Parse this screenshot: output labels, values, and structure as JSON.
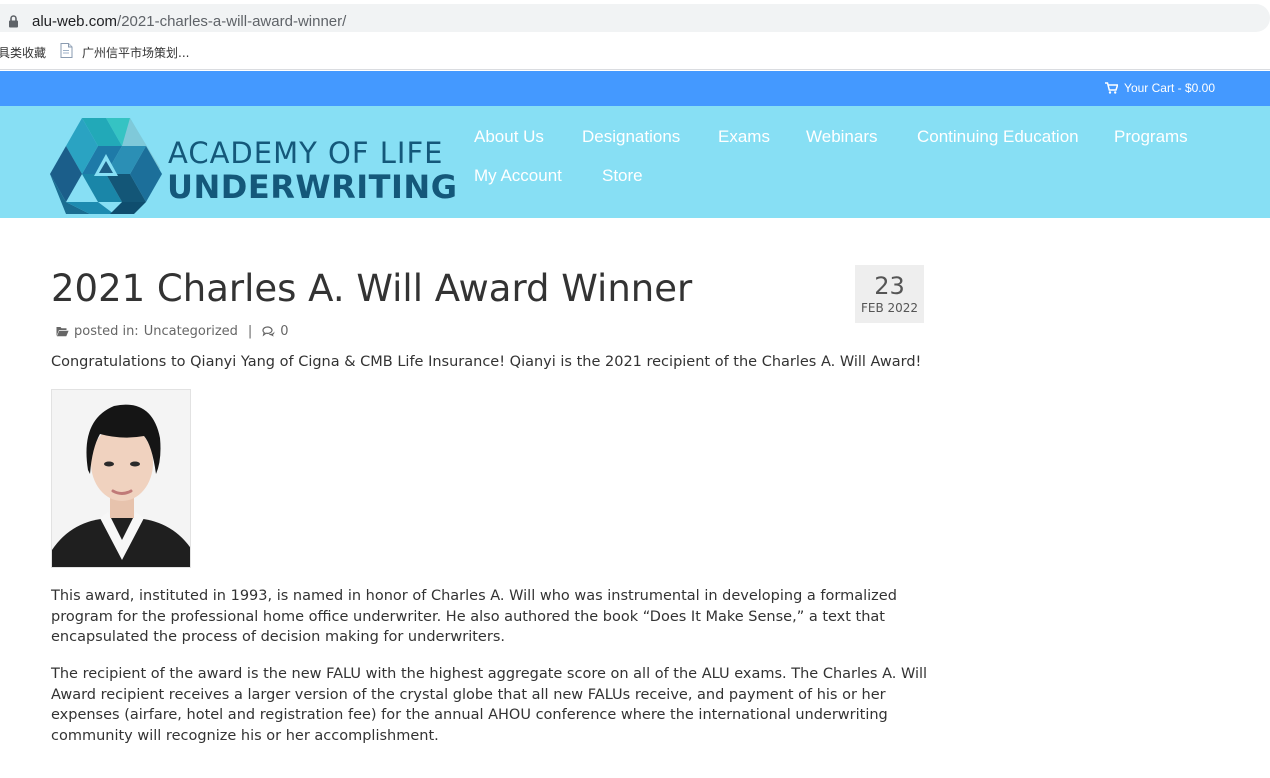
{
  "browser": {
    "url_host": "alu-web.com",
    "url_path": "/2021-charles-a-will-award-winner/",
    "bookmarks": [
      {
        "label": "具类收藏"
      },
      {
        "label": "广州信平市场策划..."
      }
    ]
  },
  "cart": {
    "label": "Your Cart - $0.00"
  },
  "logo": {
    "line1": "ACADEMY OF LIFE",
    "line2": "UNDERWRITING"
  },
  "nav": {
    "items": [
      {
        "label": "About Us"
      },
      {
        "label": "Designations"
      },
      {
        "label": "Exams"
      },
      {
        "label": "Webinars"
      },
      {
        "label": "Continuing Education"
      },
      {
        "label": "Programs"
      },
      {
        "label": "My Account"
      },
      {
        "label": "Store"
      }
    ]
  },
  "post": {
    "title": "2021 Charles A. Will Award Winner",
    "date_day": "23",
    "date_month": "FEB 2022",
    "posted_in_label": "posted in:",
    "category": "Uncategorized",
    "separator": "|",
    "comment_count": "0",
    "lead": "Congratulations to Qianyi Yang of Cigna & CMB Life Insurance! Qianyi is the 2021 recipient of the Charles A. Will Award!",
    "paragraphs": [
      "This award, instituted in 1993, is named in honor of Charles A. Will who was instrumental in developing a formalized program for the professional home office underwriter. He also authored the book “Does It Make Sense,” a text that encapsulated the process of decision making for underwriters.",
      "The recipient of the award is the new FALU with the highest aggregate score on all of the ALU exams. The Charles A. Will Award recipient receives a larger version of the crystal globe that all new FALUs receive, and payment of his or her expenses (airfare, hotel and registration fee) for the annual AHOU conference where the international underwriting community will recognize his or her accomplishment."
    ]
  },
  "colors": {
    "cart_strip": "#4499ff",
    "header_bg": "#87dff4",
    "logo_text": "#14587a",
    "nav_text": "#ffffff"
  }
}
